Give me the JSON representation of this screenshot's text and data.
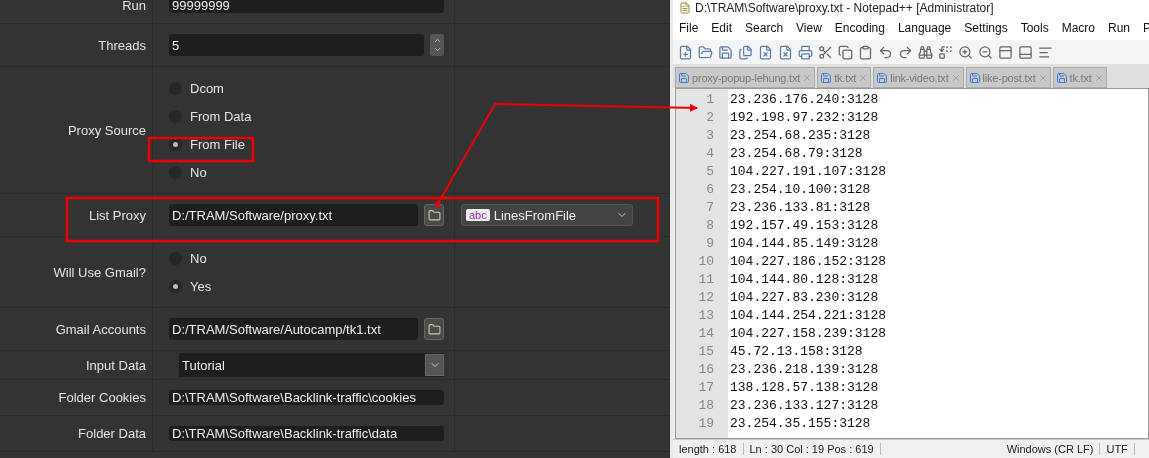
{
  "form": {
    "rows": [
      {
        "kind": "text",
        "label": "Run",
        "value": "99999999"
      },
      {
        "kind": "spinner",
        "label": "Threads",
        "value": "5"
      },
      {
        "kind": "radio",
        "label": "Proxy Source",
        "options": [
          {
            "label": "Dcom",
            "selected": false
          },
          {
            "label": "From Data",
            "selected": false
          },
          {
            "label": "From File",
            "selected": true
          },
          {
            "label": "No",
            "selected": false
          }
        ]
      },
      {
        "kind": "file",
        "label": "List Proxy",
        "value": "D:/TRAM/Software/proxy.txt",
        "type_select": {
          "badge": "abc",
          "value": "LinesFromFile"
        }
      },
      {
        "kind": "radio",
        "label": "Will Use Gmail?",
        "options": [
          {
            "label": "No",
            "selected": false
          },
          {
            "label": "Yes",
            "selected": true
          }
        ]
      },
      {
        "kind": "file",
        "label": "Gmail Accounts",
        "value": "D:/TRAM/Software/Autocamp/tk1.txt"
      },
      {
        "kind": "select",
        "label": "Input Data",
        "value": "Tutorial"
      },
      {
        "kind": "text",
        "label": "Folder Cookies",
        "value": "D:\\TRAM\\Software\\Backlink-traffic\\cookies"
      },
      {
        "kind": "text",
        "label": "Folder Data",
        "value": "D:\\TRAM\\Software\\Backlink-traffic\\data"
      }
    ]
  },
  "notepad": {
    "title": "D:\\TRAM\\Software\\proxy.txt - Notepad++ [Administrator]",
    "menu": [
      "File",
      "Edit",
      "Search",
      "View",
      "Encoding",
      "Language",
      "Settings",
      "Tools",
      "Macro",
      "Run",
      "P"
    ],
    "tabs": [
      {
        "label": "proxy-popup-lehung.txt",
        "selected": false
      },
      {
        "label": "tk.txt",
        "selected": false
      },
      {
        "label": "link-video.txt",
        "selected": false
      },
      {
        "label": "like-post.txt",
        "selected": false
      },
      {
        "label": "tk.txt",
        "selected": false
      }
    ],
    "lines": [
      {
        "number": "1",
        "text": "23.236.176.240:3128"
      },
      {
        "number": "2",
        "text": "192.198.97.232:3128"
      },
      {
        "number": "3",
        "text": "23.254.68.235:3128"
      },
      {
        "number": "4",
        "text": "23.254.68.79:3128"
      },
      {
        "number": "5",
        "text": "104.227.191.107:3128"
      },
      {
        "number": "6",
        "text": "23.254.10.100:3128"
      },
      {
        "number": "7",
        "text": "23.236.133.81:3128"
      },
      {
        "number": "8",
        "text": "192.157.49.153:3128"
      },
      {
        "number": "9",
        "text": "104.144.85.149:3128"
      },
      {
        "number": "10",
        "text": "104.227.186.152:3128"
      },
      {
        "number": "11",
        "text": "104.144.80.128:3128"
      },
      {
        "number": "12",
        "text": "104.227.83.230:3128"
      },
      {
        "number": "13",
        "text": "104.144.254.221:3128"
      },
      {
        "number": "14",
        "text": "104.227.158.239:3128"
      },
      {
        "number": "15",
        "text": "45.72.13.158:3128"
      },
      {
        "number": "16",
        "text": "23.236.218.139:3128"
      },
      {
        "number": "17",
        "text": "138.128.57.138:3128"
      },
      {
        "number": "18",
        "text": "23.236.133.127:3128"
      },
      {
        "number": "19",
        "text": "23.254.35.155:3128"
      }
    ],
    "status": [
      "length : 618",
      "Ln : 30    Col : 19    Pos : 619",
      "Windows (CR LF)",
      "UTF"
    ]
  }
}
